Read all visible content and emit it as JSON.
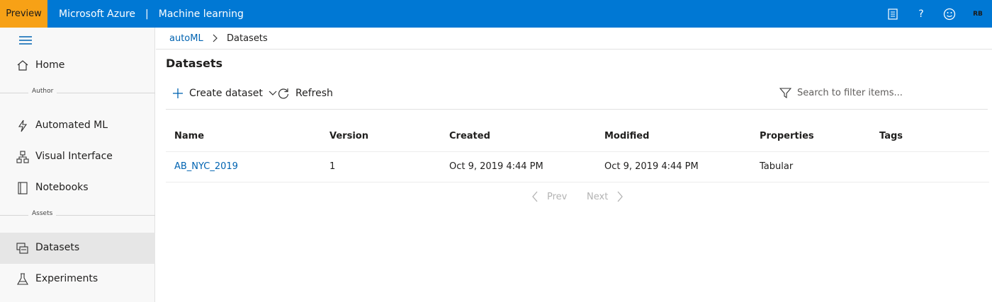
{
  "topbar": {
    "preview": "Preview",
    "brand": "Microsoft Azure",
    "separator": "|",
    "app": "Machine learning",
    "icons": [
      "notes-icon",
      "help-icon",
      "smiley-icon"
    ],
    "help_glyph": "?",
    "avatar": "RB"
  },
  "sidebar": {
    "home": "Home",
    "section_author": "Author",
    "automated_ml": "Automated ML",
    "visual_interface": "Visual Interface",
    "notebooks": "Notebooks",
    "section_assets": "Assets",
    "datasets": "Datasets",
    "experiments": "Experiments"
  },
  "breadcrumb": {
    "parent": "autoML",
    "current": "Datasets"
  },
  "page": {
    "title": "Datasets"
  },
  "toolbar": {
    "create_label": "Create dataset",
    "refresh_label": "Refresh",
    "search_placeholder": "Search to filter items..."
  },
  "table": {
    "columns": [
      "Name",
      "Version",
      "Created",
      "Modified",
      "Properties",
      "Tags"
    ],
    "rows": [
      [
        "AB_NYC_2019",
        "1",
        "Oct 9, 2019 4:44 PM",
        "Oct 9, 2019 4:44 PM",
        "Tabular",
        ""
      ]
    ]
  },
  "pager": {
    "prev": "Prev",
    "next": "Next"
  },
  "colors": {
    "topbar": "#0078d4",
    "preview_badge": "#f7a116",
    "link": "#0063b1",
    "sidebar_bg": "#f8f8f8",
    "active_item": "#e6e6e6"
  }
}
